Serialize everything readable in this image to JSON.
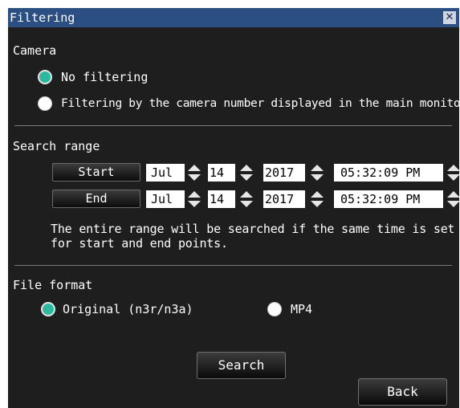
{
  "window": {
    "title": "Filtering",
    "close_glyph": "✕"
  },
  "camera": {
    "heading": "Camera",
    "options": [
      {
        "label": "No filtering",
        "selected": true
      },
      {
        "label": "Filtering by the camera number displayed in the main monitor",
        "selected": false
      }
    ]
  },
  "search_range": {
    "heading": "Search range",
    "start": {
      "label": "Start",
      "month": "Jul",
      "day": "14",
      "year": "2017",
      "time": "05:32:09 PM"
    },
    "end": {
      "label": "End",
      "month": "Jul",
      "day": "14",
      "year": "2017",
      "time": "05:32:09 PM"
    },
    "hint_line1": "The entire range will be searched if the same time is set",
    "hint_line2": "for start and end points."
  },
  "file_format": {
    "heading": "File format",
    "options": [
      {
        "label": "Original (n3r/n3a)",
        "selected": true
      },
      {
        "label": "MP4",
        "selected": false
      }
    ]
  },
  "buttons": {
    "search": "Search",
    "back": "Back"
  },
  "colors": {
    "titlebar": "#2b4f83",
    "panel": "#1e1e1e",
    "radio_selected": "#2fb8a0"
  }
}
